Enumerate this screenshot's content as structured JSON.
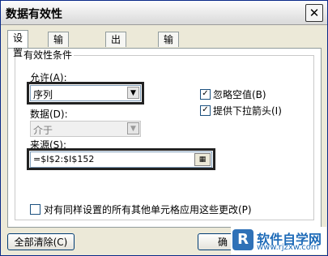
{
  "window": {
    "title": "数据有效性",
    "close_glyph": "✕"
  },
  "tabs": [
    {
      "label": "设置",
      "active": true
    },
    {
      "label": "输入信息",
      "active": false
    },
    {
      "label": "出错警告",
      "active": false
    },
    {
      "label": "输入法模式",
      "active": false
    }
  ],
  "criteria": {
    "legend": "有效性条件",
    "allow_label": "允许(A):",
    "allow_value": "序列",
    "data_label": "数据(D):",
    "data_value": "介于",
    "source_label": "来源(S):",
    "source_value": "=$I$2:$I$152",
    "ignore_blank_label": "忽略空值(B)",
    "ignore_blank_checked": true,
    "dropdown_label": "提供下拉箭头(I)",
    "dropdown_checked": true
  },
  "apply_all": {
    "label": "对有同样设置的所有其他单元格应用这些更改(P)",
    "checked": false
  },
  "buttons": {
    "clear_all": "全部清除(C)",
    "ok": "确"
  },
  "watermark": {
    "logo": "R",
    "text": "软件自学网",
    "sub": "www.rjzxw.com"
  },
  "colors": {
    "title_border": "#0a2a88",
    "dialog_bg": "#ece9d8",
    "checkbox_border": "#1c5180",
    "watermark": "#1e6bb8"
  }
}
